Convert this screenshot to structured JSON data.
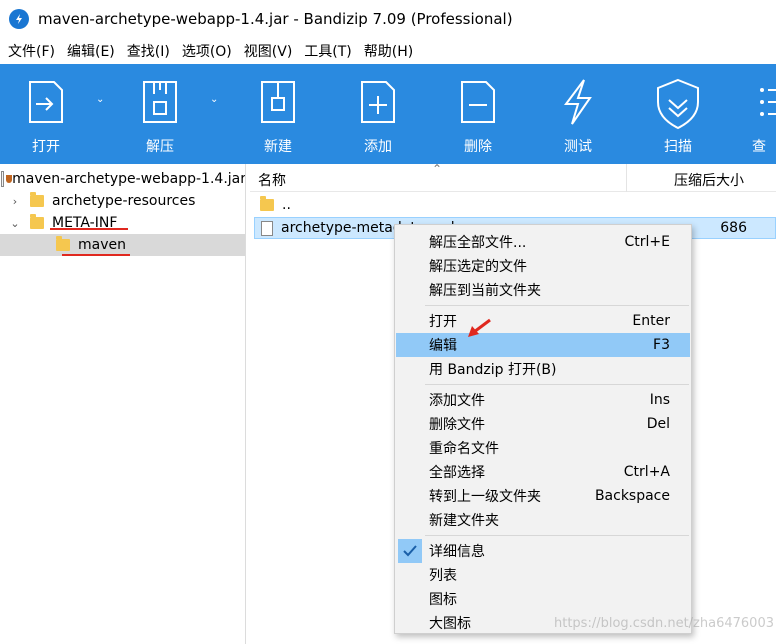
{
  "window": {
    "title": "maven-archetype-webapp-1.4.jar - Bandizip 7.09 (Professional)"
  },
  "menubar": [
    {
      "label": "文件(F)"
    },
    {
      "label": "编辑(E)"
    },
    {
      "label": "查找(I)"
    },
    {
      "label": "选项(O)"
    },
    {
      "label": "视图(V)"
    },
    {
      "label": "工具(T)"
    },
    {
      "label": "帮助(H)"
    }
  ],
  "toolbar": {
    "open_label": "打开",
    "extract_label": "解压",
    "new_label": "新建",
    "add_label": "添加",
    "delete_label": "删除",
    "test_label": "测试",
    "scan_label": "扫描",
    "view_label": "查",
    "colors": {
      "background": "#2a8ae0"
    }
  },
  "tree": {
    "root": "maven-archetype-webapp-1.4.jar",
    "items": [
      {
        "label": "archetype-resources"
      },
      {
        "label": "META-INF"
      },
      {
        "label": "maven"
      }
    ]
  },
  "filelist": {
    "columns": {
      "name": "名称",
      "size": "压缩后大小"
    },
    "rows": [
      {
        "name": "..",
        "size": ""
      },
      {
        "name": "archetype-metadata.xml",
        "size": "686"
      }
    ]
  },
  "context_menu": {
    "groups": [
      [
        {
          "label": "解压全部文件...",
          "shortcut": "Ctrl+E"
        },
        {
          "label": "解压选定的文件",
          "shortcut": ""
        },
        {
          "label": "解压到当前文件夹",
          "shortcut": ""
        }
      ],
      [
        {
          "label": "打开",
          "shortcut": "Enter"
        },
        {
          "label": "编辑",
          "shortcut": "F3"
        },
        {
          "label": "用 Bandzip 打开(B)",
          "shortcut": ""
        }
      ],
      [
        {
          "label": "添加文件",
          "shortcut": "Ins"
        },
        {
          "label": "删除文件",
          "shortcut": "Del"
        },
        {
          "label": "重命名文件",
          "shortcut": ""
        },
        {
          "label": "全部选择",
          "shortcut": "Ctrl+A"
        },
        {
          "label": "转到上一级文件夹",
          "shortcut": "Backspace"
        },
        {
          "label": "新建文件夹",
          "shortcut": ""
        }
      ],
      [
        {
          "label": "详细信息",
          "shortcut": ""
        },
        {
          "label": "列表",
          "shortcut": ""
        },
        {
          "label": "图标",
          "shortcut": ""
        },
        {
          "label": "大图标",
          "shortcut": ""
        }
      ]
    ],
    "highlight_color": "#91c9f7"
  },
  "watermark": "https://blog.csdn.net/zha6476003"
}
